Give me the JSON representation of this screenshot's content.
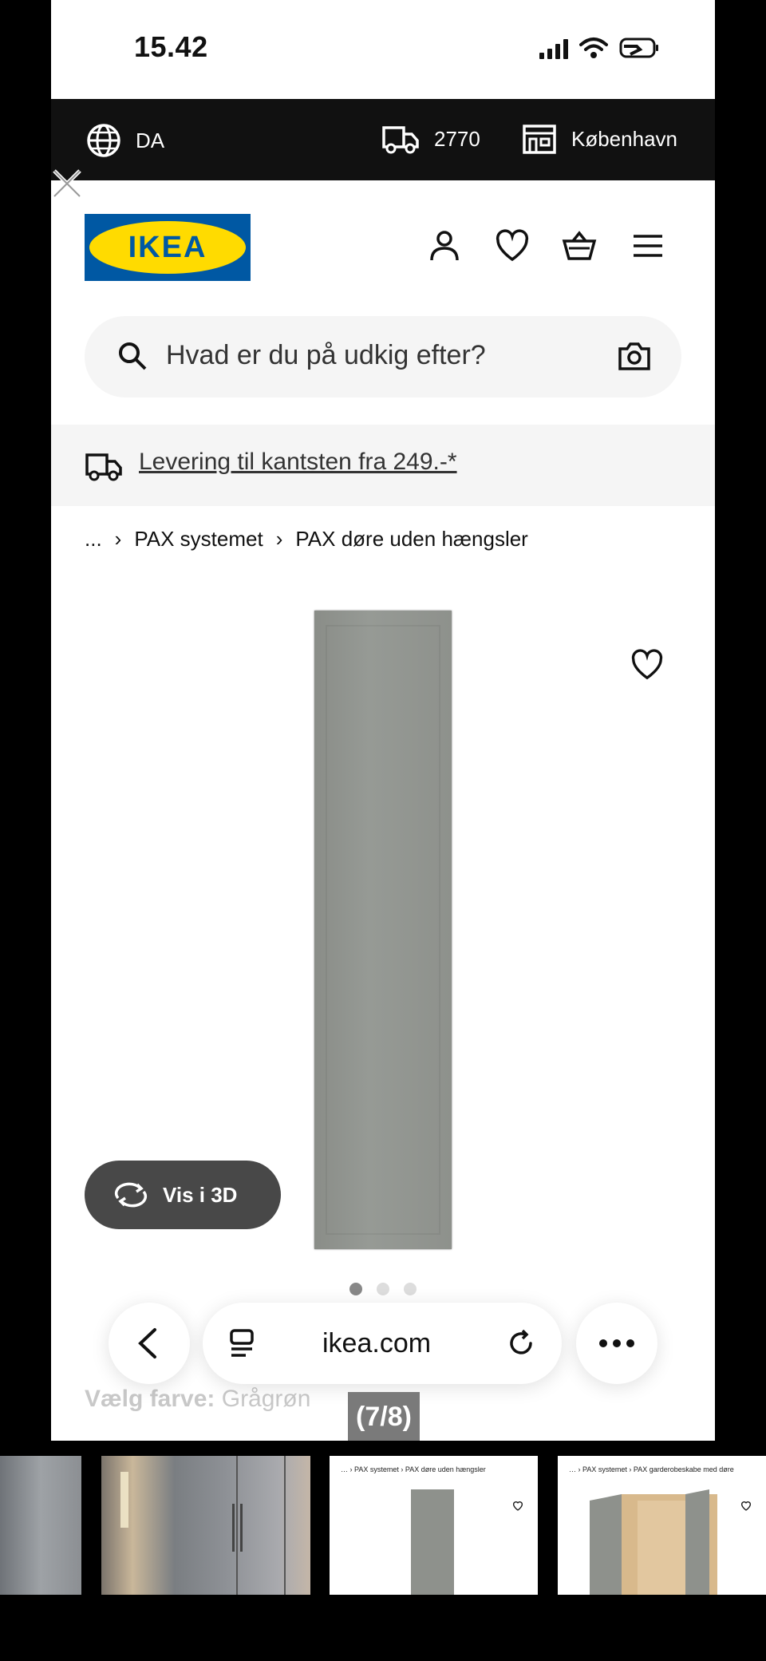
{
  "status_bar": {
    "time": "15.42"
  },
  "topbar": {
    "language": "DA",
    "postal_code": "2770",
    "store": "København"
  },
  "brand": {
    "logo_text": "IKEA"
  },
  "search": {
    "placeholder": "Hvad er du på udkig efter?"
  },
  "delivery": {
    "text": "Levering til kantsten fra 249.-*"
  },
  "breadcrumb": {
    "ellipsis": "...",
    "items": [
      "PAX systemet",
      "PAX døre uden hængsler"
    ]
  },
  "product": {
    "view_3d_label": "Vis i 3D",
    "image_count": 3,
    "active_image_index": 0
  },
  "browser": {
    "url": "ikea.com"
  },
  "color_choice": {
    "label": "Vælg farve:",
    "value": "Grågrøn"
  },
  "viewer": {
    "counter": "(7/8)"
  },
  "thumbnails": {
    "thumb3_breadcrumb": [
      "PAX systemet",
      "PAX døre uden hængsler"
    ],
    "thumb4_breadcrumb": [
      "PAX systemet",
      "PAX garderobeskabe med døre"
    ]
  },
  "colors": {
    "topbar_bg": "#111111",
    "ikea_blue": "#0058a3",
    "ikea_yellow": "#ffdb00",
    "door_grey_green": "#8e918c"
  }
}
